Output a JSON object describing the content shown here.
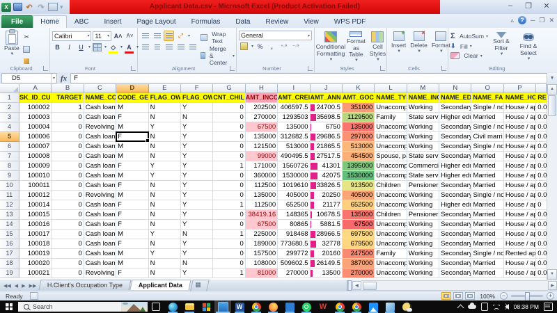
{
  "window": {
    "title": "Applicant Data.csv - Microsoft Excel (Product Activation Failed)",
    "title_bg": "#DD0A0A",
    "controls": {
      "minimize": "–",
      "restore": "❐",
      "close": "✕"
    }
  },
  "ribbon": {
    "tabs": [
      {
        "label": "File",
        "file": true
      },
      {
        "label": "Home",
        "active": true
      },
      {
        "label": "ABC"
      },
      {
        "label": "Insert"
      },
      {
        "label": "Page Layout"
      },
      {
        "label": "Formulas"
      },
      {
        "label": "Data"
      },
      {
        "label": "Review"
      },
      {
        "label": "View"
      },
      {
        "label": "WPS PDF"
      }
    ],
    "clipboard": {
      "label": "Clipboard",
      "paste": "Paste"
    },
    "font": {
      "label": "Font",
      "font_name": "Calibri",
      "font_size": "11"
    },
    "alignment": {
      "label": "Alignment",
      "wrap": "Wrap Text",
      "merge": "Merge & Center"
    },
    "number": {
      "label": "Number",
      "format": "General"
    },
    "styles": {
      "label": "Styles",
      "buttons": [
        "Conditional Formatting",
        "Format as Table",
        "Cell Styles"
      ]
    },
    "cells": {
      "label": "Cells",
      "buttons": [
        "Insert",
        "Delete",
        "Format"
      ]
    },
    "editing": {
      "label": "Editing",
      "autosum": "AutoSum",
      "fill": "Fill",
      "clear": "Clear",
      "sort": "Sort & Filter",
      "find": "Find & Select"
    }
  },
  "formula_bar": {
    "name_box": "D5",
    "fx": "fx",
    "content": "F"
  },
  "grid": {
    "col_letters": [
      "A",
      "B",
      "C",
      "D",
      "E",
      "F",
      "G",
      "H",
      "I",
      "J",
      "K",
      "L",
      "M",
      "N",
      "O",
      "P"
    ],
    "selected_col": "D",
    "selected_row": 5,
    "selected_cell": "D5",
    "aligns": [
      "r",
      "r",
      "l",
      "l",
      "l",
      "l",
      "r",
      "r",
      "r",
      "r",
      "r",
      "l",
      "l",
      "l",
      "l",
      "l",
      "l"
    ],
    "header_bg": "#FFFF00",
    "income_header_bg": "#F9A4B2",
    "income_low_bg": "#FFC7CE",
    "income_low_text": "#9C0006",
    "annuity_bar_color": "#E0218A",
    "annuity_max": 42075,
    "income_low_rows": [
      4,
      7,
      13,
      14,
      19
    ],
    "goods_colors": [
      "#FB9B75",
      "#B8D780",
      "#F9756D",
      "#FA9273",
      "#FCB87A",
      "#FBAE78",
      "#80C67D",
      "#63BE7B",
      "#E7E483",
      "#FBA577",
      "#FDCF7F",
      "#F9756D",
      "#F8696B",
      "#FED981",
      "#FED680",
      "#FA8971",
      "#FBA276",
      "#FA8D72"
    ],
    "rows": [
      {
        "n": 1,
        "header": true,
        "cells": [
          "SK_ID_CUI",
          "TARGET",
          "NAME_CO",
          "CODE_GEI",
          "FLAG_OW",
          "FLAG_OW",
          "CNT_CHIL",
          "AMT_INCO",
          "AMT_CREI",
          "AMT_ANN",
          "AMT_GOC",
          "NAME_TYI",
          "NAME_INC",
          "NAME_ED",
          "NAME_FAI",
          "NAME_HC",
          "REG"
        ]
      },
      {
        "n": 2,
        "cells": [
          "100002",
          "1",
          "Cash loans",
          "M",
          "N",
          "Y",
          "0",
          "202500",
          "406597.5",
          "24700.5",
          "351000",
          "Unaccomp",
          "Working",
          "Secondary",
          "Single / no",
          "House / ap",
          "0.0"
        ]
      },
      {
        "n": 3,
        "cells": [
          "100003",
          "0",
          "Cash loans",
          "F",
          "N",
          "N",
          "0",
          "270000",
          "1293503",
          "35698.5",
          "1129500",
          "Family",
          "State serv",
          "Higher edu",
          "Married",
          "House / ap",
          "0.0"
        ]
      },
      {
        "n": 4,
        "cells": [
          "100004",
          "0",
          "Revolving l",
          "M",
          "Y",
          "Y",
          "0",
          "67500",
          "135000",
          "6750",
          "135000",
          "Unaccomp",
          "Working",
          "Secondary",
          "Single / no",
          "House / ap",
          "0.0"
        ]
      },
      {
        "n": 5,
        "cells": [
          "100006",
          "0",
          "Cash loans",
          "F",
          "N",
          "Y",
          "0",
          "135000",
          "312682.5",
          "29686.5",
          "297000",
          "Unaccomp",
          "Working",
          "Secondary",
          "Civil marri",
          "House / ap",
          "0.0"
        ]
      },
      {
        "n": 6,
        "cells": [
          "100007",
          "0",
          "Cash loans",
          "M",
          "N",
          "Y",
          "0",
          "121500",
          "513000",
          "21865.5",
          "513000",
          "Unaccomp",
          "Working",
          "Secondary",
          "Single / no",
          "House / ap",
          "0.0"
        ]
      },
      {
        "n": 7,
        "cells": [
          "100008",
          "0",
          "Cash loans",
          "M",
          "N",
          "Y",
          "0",
          "99000",
          "490495.5",
          "27517.5",
          "454500",
          "Spouse, pa",
          "State serv",
          "Secondary",
          "Married",
          "House / ap",
          "0.0"
        ]
      },
      {
        "n": 8,
        "cells": [
          "100009",
          "0",
          "Cash loans",
          "F",
          "Y",
          "Y",
          "1",
          "171000",
          "1560726",
          "41301",
          "1395000",
          "Unaccomp",
          "Commerci",
          "Higher edu",
          "Married",
          "House / ap",
          "0.0"
        ]
      },
      {
        "n": 9,
        "cells": [
          "100010",
          "0",
          "Cash loans",
          "M",
          "Y",
          "Y",
          "0",
          "360000",
          "1530000",
          "42075",
          "1530000",
          "Unaccomp",
          "State serv",
          "Higher edu",
          "Married",
          "House / ap",
          "0.0"
        ]
      },
      {
        "n": 10,
        "cells": [
          "100011",
          "0",
          "Cash loans",
          "F",
          "N",
          "Y",
          "0",
          "112500",
          "1019610",
          "33826.5",
          "913500",
          "Children",
          "Pensioner",
          "Secondary",
          "Married",
          "House / ap",
          "0.0"
        ]
      },
      {
        "n": 11,
        "cells": [
          "100012",
          "0",
          "Revolving l",
          "M",
          "N",
          "Y",
          "0",
          "135000",
          "405000",
          "20250",
          "405000",
          "Unaccomp",
          "Working",
          "Secondary",
          "Single / no",
          "House / ap",
          "0.0"
        ]
      },
      {
        "n": 12,
        "cells": [
          "100014",
          "0",
          "Cash loans",
          "F",
          "N",
          "Y",
          "1",
          "112500",
          "652500",
          "21177",
          "652500",
          "Unaccomp",
          "Working",
          "Higher edu",
          "Married",
          "House / ap",
          "0"
        ]
      },
      {
        "n": 13,
        "cells": [
          "100015",
          "0",
          "Cash loans",
          "F",
          "N",
          "Y",
          "0",
          "38419.16",
          "148365",
          "10678.5",
          "135000",
          "Children",
          "Pensioner",
          "Secondary",
          "Married",
          "House / ap",
          "0.0"
        ]
      },
      {
        "n": 14,
        "cells": [
          "100016",
          "0",
          "Cash loans",
          "F",
          "N",
          "Y",
          "0",
          "67500",
          "80865",
          "5881.5",
          "67500",
          "Unaccomp",
          "Working",
          "Secondary",
          "Married",
          "House / ap",
          "0.0"
        ]
      },
      {
        "n": 15,
        "cells": [
          "100017",
          "0",
          "Cash loans",
          "M",
          "Y",
          "N",
          "1",
          "225000",
          "918468",
          "28966.5",
          "697500",
          "Unaccomp",
          "Working",
          "Secondary",
          "Married",
          "House / ap",
          "0.0"
        ]
      },
      {
        "n": 16,
        "cells": [
          "100018",
          "0",
          "Cash loans",
          "F",
          "N",
          "Y",
          "0",
          "189000",
          "773680.5",
          "32778",
          "679500",
          "Unaccomp",
          "Working",
          "Secondary",
          "Married",
          "House / ap",
          "0.0"
        ]
      },
      {
        "n": 17,
        "cells": [
          "100019",
          "0",
          "Cash loans",
          "M",
          "Y",
          "Y",
          "0",
          "157500",
          "299772",
          "20160",
          "247500",
          "Family",
          "Working",
          "Secondary",
          "Single / no",
          "Rented ap",
          "0.0"
        ]
      },
      {
        "n": 18,
        "cells": [
          "100020",
          "0",
          "Cash loans",
          "M",
          "N",
          "N",
          "0",
          "108000",
          "509602.5",
          "26149.5",
          "387000",
          "Unaccomp",
          "Working",
          "Secondary",
          "Married",
          "House / ap",
          "0.0"
        ]
      },
      {
        "n": 19,
        "cells": [
          "100021",
          "0",
          "Revolving l",
          "F",
          "N",
          "Y",
          "1",
          "81000",
          "270000",
          "13500",
          "270000",
          "Unaccomp",
          "Working",
          "Secondary",
          "Married",
          "House / ap",
          "0.0"
        ]
      }
    ]
  },
  "sheet_tabs": {
    "tabs": [
      {
        "label": "H.Client's Occupation Type"
      },
      {
        "label": "Applicant Data",
        "active": true
      }
    ]
  },
  "status_bar": {
    "left": "Ready",
    "zoom": "100%"
  },
  "taskbar": {
    "search_placeholder": "Search",
    "time": "08:38 PM",
    "apps": [
      {
        "id": "task-view",
        "running": false
      },
      {
        "id": "edge",
        "running": true
      },
      {
        "id": "file-explorer",
        "running": true
      },
      {
        "id": "store",
        "running": false
      },
      {
        "id": "excel-window",
        "running": true,
        "active": true
      },
      {
        "id": "word",
        "running": true,
        "glyph": "W"
      },
      {
        "id": "chrome",
        "running": true
      },
      {
        "id": "firefox",
        "running": true
      },
      {
        "id": "movies",
        "running": true
      },
      {
        "id": "whatsapp",
        "running": true
      },
      {
        "id": "wps",
        "running": false,
        "glyph": "W"
      },
      {
        "id": "chrome-2",
        "running": true
      },
      {
        "id": "chrome-3",
        "running": true
      },
      {
        "id": "photos",
        "running": true
      },
      {
        "id": "snip",
        "running": true
      },
      {
        "id": "weather",
        "running": false
      }
    ]
  }
}
